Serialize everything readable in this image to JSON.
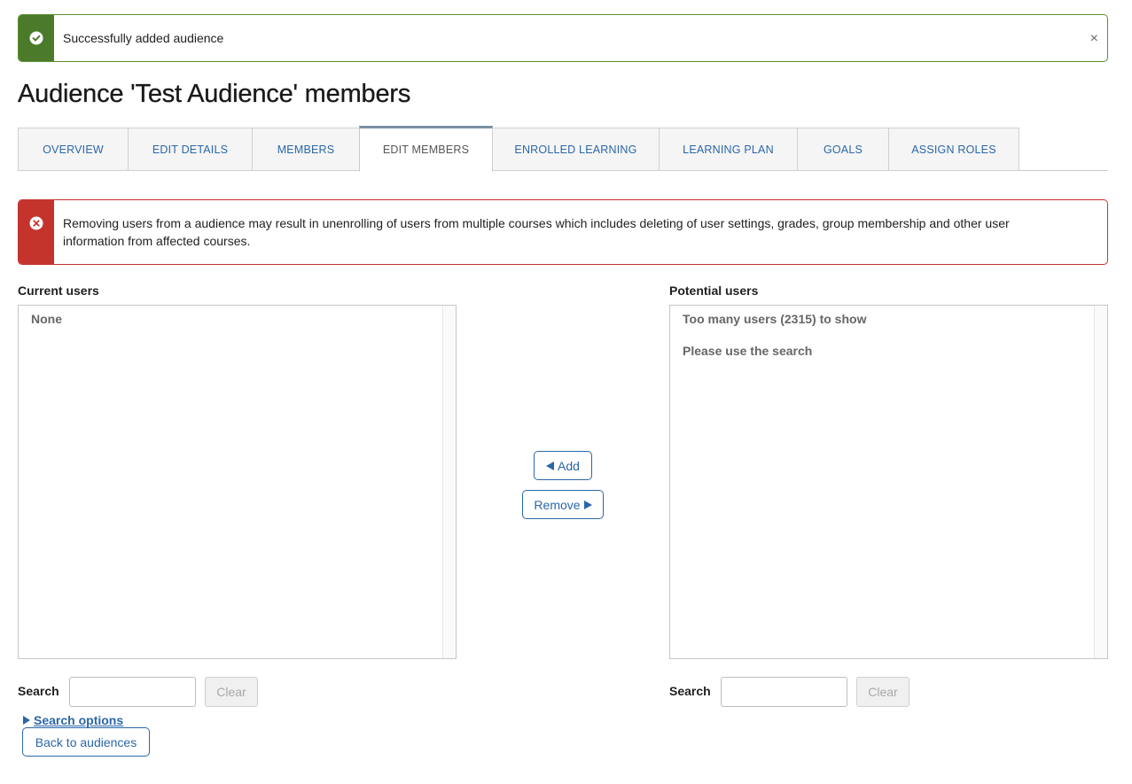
{
  "success_alert": {
    "message": "Successfully added audience",
    "close": "×"
  },
  "page_title": "Audience 'Test Audience' members",
  "tabs": [
    {
      "label": "OVERVIEW"
    },
    {
      "label": "EDIT DETAILS"
    },
    {
      "label": "MEMBERS"
    },
    {
      "label": "EDIT MEMBERS",
      "active": true
    },
    {
      "label": "ENROLLED LEARNING"
    },
    {
      "label": "LEARNING PLAN"
    },
    {
      "label": "GOALS"
    },
    {
      "label": "ASSIGN ROLES"
    }
  ],
  "warning_alert": {
    "message": "Removing users from a audience may result in unenrolling of users from multiple courses which includes deleting of user settings, grades, group membership and other user information from affected courses."
  },
  "current_users": {
    "label": "Current users",
    "options": [
      "None"
    ],
    "search_label": "Search",
    "clear_label": "Clear"
  },
  "potential_users": {
    "label": "Potential users",
    "options": [
      "Too many users (2315) to show",
      "Please use the search"
    ],
    "search_label": "Search",
    "clear_label": "Clear"
  },
  "actions": {
    "add_label": "Add",
    "remove_label": "Remove"
  },
  "search_options_label": "Search options",
  "back_label": "Back to audiences",
  "colors": {
    "success": "#4b7b2a",
    "danger": "#c4342d",
    "link": "#2a67a8"
  }
}
